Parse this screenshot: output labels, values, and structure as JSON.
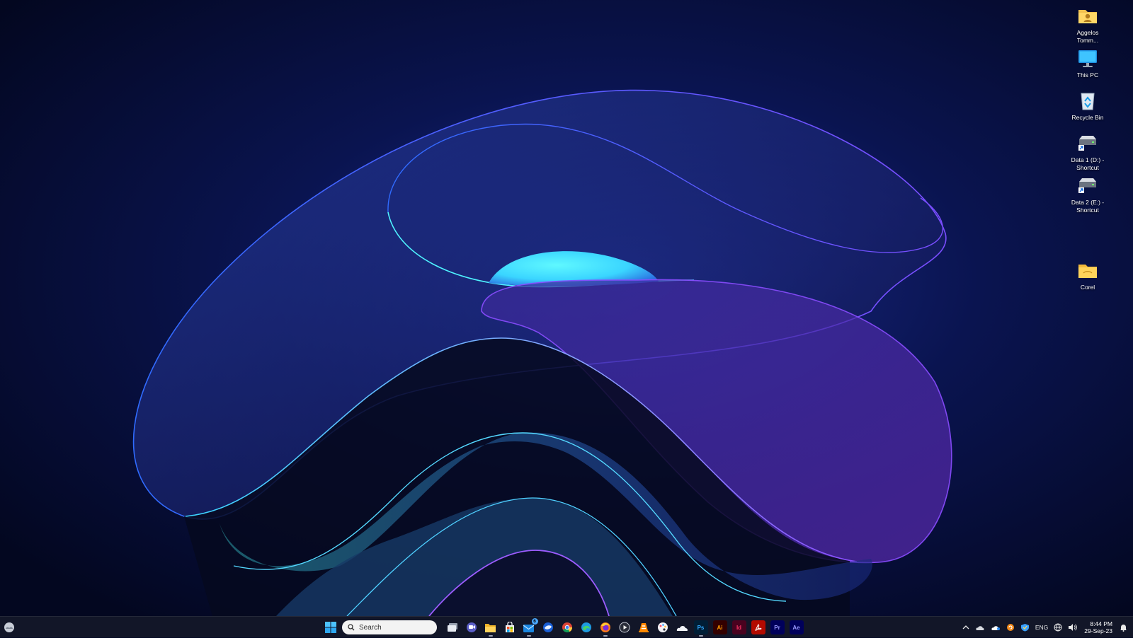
{
  "desktop": {
    "icons": [
      {
        "label": "Aggelos Tomm...",
        "icon": "user-folder-icon"
      },
      {
        "label": "This PC",
        "icon": "monitor-icon"
      },
      {
        "label": "Recycle Bin",
        "icon": "recycle-bin-icon"
      },
      {
        "label": "Data 1 (D:) - Shortcut",
        "icon": "drive-shortcut-icon"
      },
      {
        "label": "Data 2 (E:) - Shortcut",
        "icon": "drive-shortcut-icon"
      },
      {
        "label": "Corel",
        "icon": "folder-icon"
      }
    ]
  },
  "taskbar": {
    "search_placeholder": "Search",
    "mail_badge": "6",
    "pinned": [
      {
        "name": "task-view",
        "icon": "task-view-icon"
      },
      {
        "name": "teams-chat",
        "icon": "chat-icon"
      },
      {
        "name": "file-explorer",
        "icon": "folder-icon"
      },
      {
        "name": "microsoft-store",
        "icon": "store-icon"
      },
      {
        "name": "mail",
        "icon": "mail-icon"
      },
      {
        "name": "thunderbird",
        "icon": "thunderbird-icon"
      },
      {
        "name": "chrome",
        "icon": "chrome-icon"
      },
      {
        "name": "edge",
        "icon": "edge-icon"
      },
      {
        "name": "firefox",
        "icon": "firefox-icon"
      },
      {
        "name": "media-player",
        "icon": "media-player-icon"
      },
      {
        "name": "vlc",
        "icon": "vlc-icon"
      },
      {
        "name": "paint-app",
        "icon": "palette-icon"
      },
      {
        "name": "cloud-app",
        "icon": "cloud-icon"
      }
    ],
    "adobe_apps": [
      {
        "label": "Ps",
        "name": "photoshop",
        "bg": "#001e36",
        "fg": "#31a8ff"
      },
      {
        "label": "Ai",
        "name": "illustrator",
        "bg": "#330000",
        "fg": "#ff9a00"
      },
      {
        "label": "Id",
        "name": "indesign",
        "bg": "#49021f",
        "fg": "#ff3366"
      },
      {
        "label": "",
        "name": "acrobat",
        "bg": "#b30b00",
        "fg": "#ffffff"
      },
      {
        "label": "Pr",
        "name": "premiere",
        "bg": "#00005b",
        "fg": "#9999ff"
      },
      {
        "label": "Ae",
        "name": "after-effects",
        "bg": "#00005b",
        "fg": "#9999ff"
      }
    ],
    "tray": {
      "language": "ENG",
      "time": "8:44 PM",
      "date": "29-Sep-23"
    }
  },
  "colors": {
    "background": "#050a26",
    "taskbar": "#141828",
    "accent_cyan": "#4ff3ff",
    "accent_violet": "#8a4dff"
  }
}
